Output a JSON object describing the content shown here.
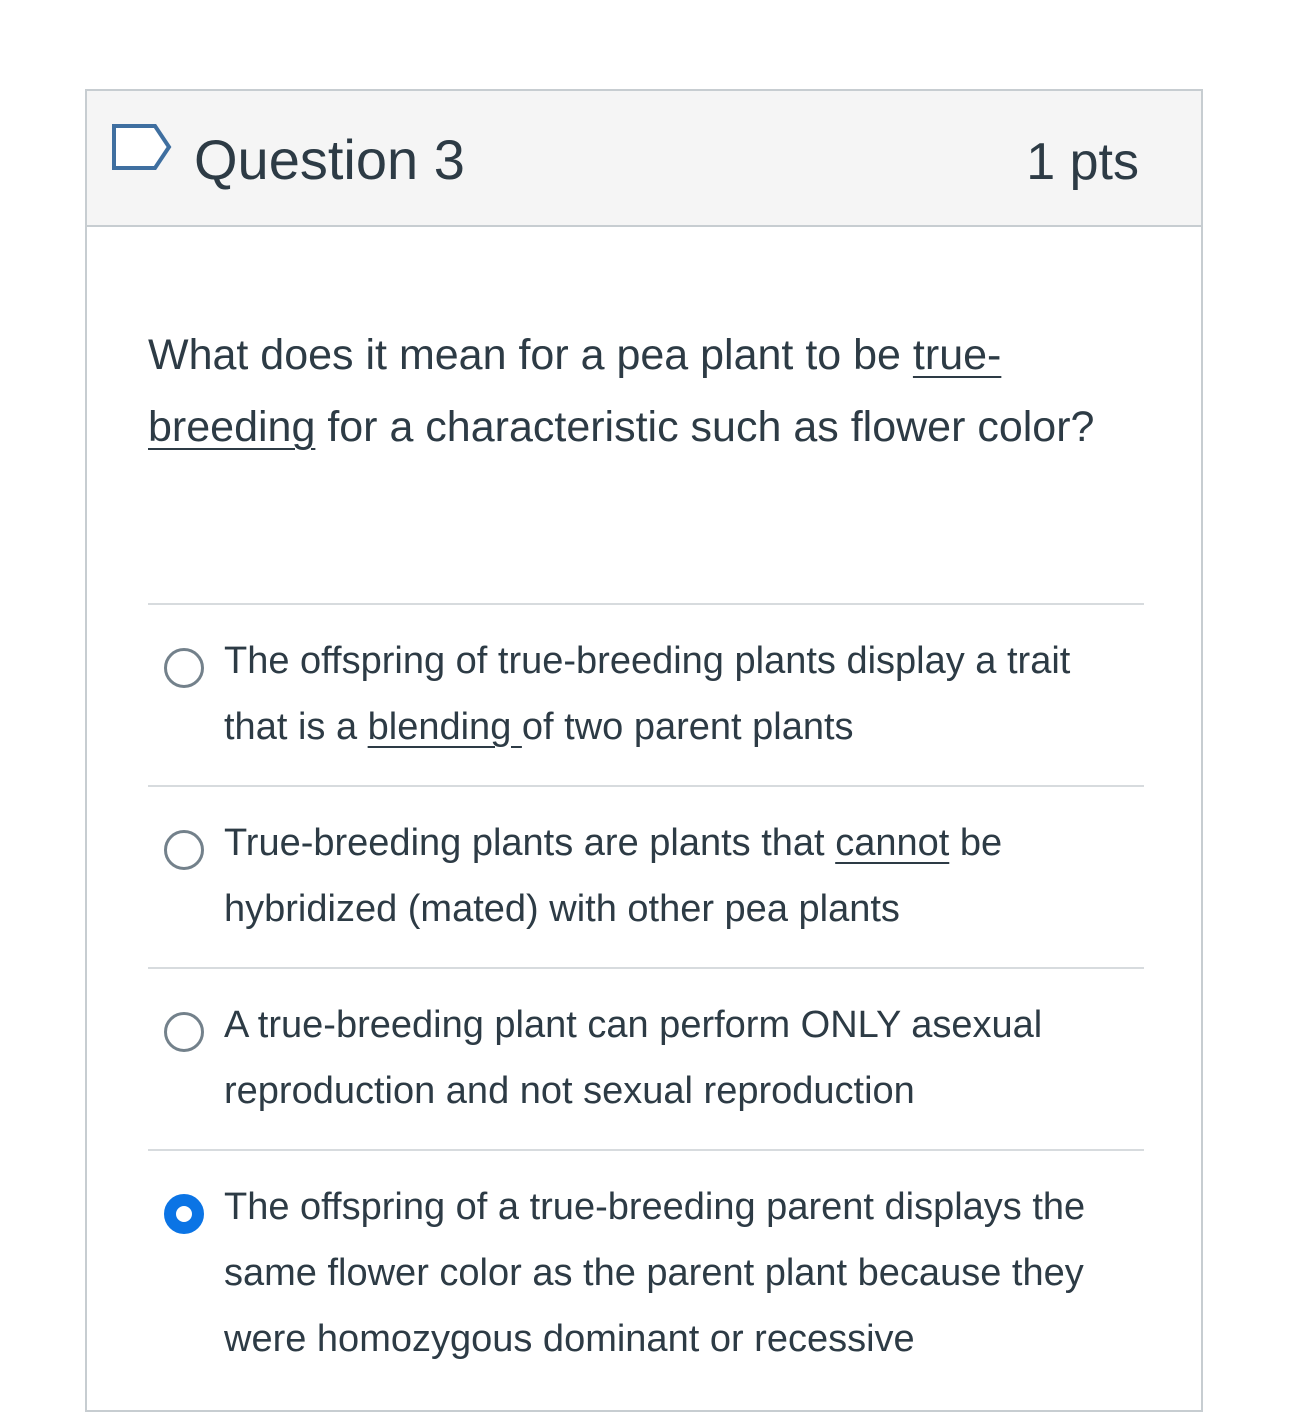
{
  "question": {
    "title": "Question 3",
    "points": "1 pts",
    "text_parts": [
      "What does it mean for a pea plant to be ",
      "true-breeding",
      " for a characteristic such as flower color?"
    ]
  },
  "answers": [
    {
      "parts": [
        "The offspring of true-breeding plants display a trait that is a ",
        "blending ",
        "of two parent plants"
      ],
      "selected": false
    },
    {
      "parts": [
        "True-breeding plants are plants that ",
        "cannot",
        " be hybridized (mated) with other pea plants"
      ],
      "selected": false
    },
    {
      "parts": [
        "A true-breeding plant can perform ONLY asexual reproduction and not sexual reproduction"
      ],
      "selected": false
    },
    {
      "parts": [
        "The offspring of a true-breeding parent displays the same flower color as the parent plant because they were homozygous dominant or recessive"
      ],
      "selected": true
    }
  ],
  "colors": {
    "text": "#2d3b45",
    "header_bg": "#f5f5f5",
    "border": "#c7cdd1",
    "radio_selected": "#0b74e5",
    "flag_outline": "#3f6fa0"
  },
  "icons": {
    "flag": "flag-question-icon"
  }
}
